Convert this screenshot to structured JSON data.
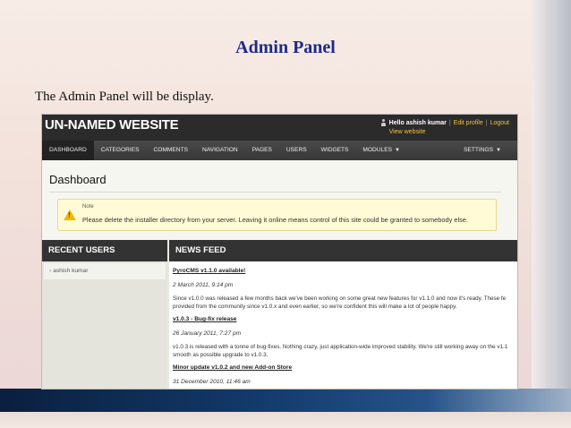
{
  "slide": {
    "title": "Admin Panel",
    "text": "The Admin Panel will be display."
  },
  "header": {
    "site_title": "UN-NAMED WEBSITE",
    "hello": "Hello ashish kumar",
    "edit_profile": "Edit profile",
    "logout": "Logout",
    "separator": "|",
    "view_website": "View website"
  },
  "nav": {
    "items": [
      "DASHBOARD",
      "CATEGORIES",
      "COMMENTS",
      "NAVIGATION",
      "PAGES",
      "USERS",
      "WIDGETS",
      "MODULES"
    ],
    "active": "DASHBOARD",
    "settings": "SETTINGS"
  },
  "dashboard": {
    "title": "Dashboard",
    "note_label": "Note",
    "note_text": "Please delete the installer directory from your server. Leaving it online means control of this site could be granted to somebody else."
  },
  "recent_users": {
    "title": "RECENT USERS",
    "items": [
      "ashish kumar"
    ]
  },
  "news_feed": {
    "title": "NEWS FEED",
    "items": [
      {
        "title": "PyroCMS v1.1.0 available!",
        "date": "2 March 2011, 9:14 pm",
        "text": [
          "Since v1.0.0 was released a few months back we've been working on some great new features for v1.1.0 and now it's ready. These fe",
          "provided from the community since v1.0.x and even earlier, so we're confident this will make a lot of people happy."
        ]
      },
      {
        "title": "v1.0.3 - Bug-fix release",
        "date": "26 January 2011, 7:27 pm",
        "text": [
          "v1.0.3 is released with a tonne of bug-fixes. Nothing crazy, just application-wide improved stability. We're still working away on the v1.1",
          "smooth as possible upgrade to v1.0.3."
        ]
      },
      {
        "title": "Minor update v1.0.2 and new Add-on Store",
        "date": "31 December 2010, 11:46 am",
        "text": []
      }
    ]
  },
  "colors": {
    "slide_title": "#1e2a86",
    "header_bg": "#2b2b2b",
    "link": "#f0c040",
    "note_bg": "#fffbd6",
    "warning": "#f2b800"
  }
}
